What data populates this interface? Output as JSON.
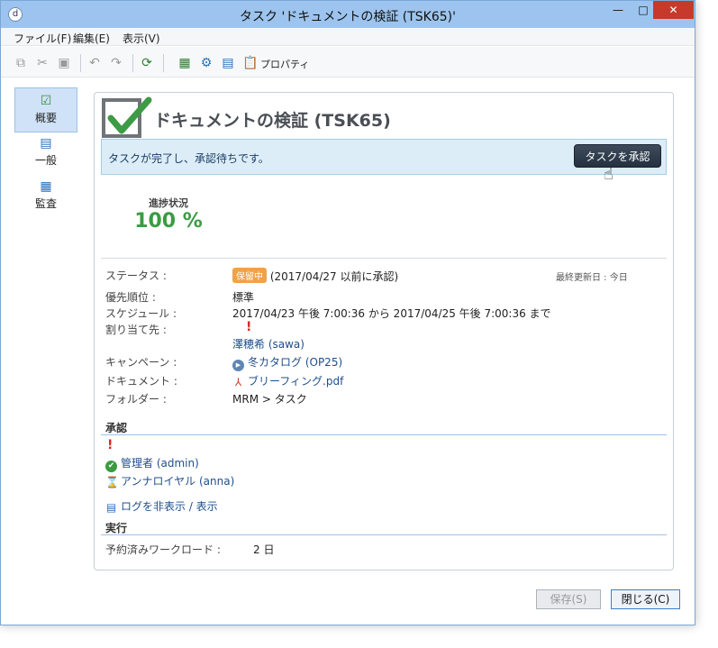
{
  "window": {
    "title": "タスク 'ドキュメントの検証 (TSK65)'",
    "app_icon": "d",
    "minimize": "—",
    "maximize": "□",
    "close": "✕"
  },
  "menu": {
    "file": "ファイル(F)",
    "edit": "編集(E)",
    "view": "表示(V)"
  },
  "toolbar": {
    "properties": "プロパティ"
  },
  "nav": [
    {
      "label": "概要",
      "icon": "☑"
    },
    {
      "label": "一般",
      "icon": "▤"
    },
    {
      "label": "監査",
      "icon": "▦"
    }
  ],
  "card": {
    "title": "ドキュメントの検証 (TSK65)",
    "status_message": "タスクが完了し、承認待ちです。",
    "approve_button": "タスクを承認",
    "progress_label": "進捗状況",
    "progress_value": "100 %"
  },
  "fields": {
    "status_label": "ステータス :",
    "status_badge": "保留中",
    "status_value": "(2017/04/27 以前に承認)",
    "last_updated": "最終更新日 : 今日",
    "priority_label": "優先順位 :",
    "priority_value": "標準",
    "schedule_label": "スケジュール :",
    "schedule_value": "2017/04/23 午後 7:00:36 から 2017/04/25 午後 7:00:36 まで",
    "assignee_label": "割り当て先 :",
    "assignee_mark": "!",
    "assignee_value": "澤穂希 (sawa)",
    "campaign_label": "キャンペーン :",
    "campaign_value": "冬カタログ (OP25)",
    "document_label": "ドキュメント :",
    "document_value": "ブリーフィング.pdf",
    "folder_label": "フォルダー :",
    "folder_value": "MRM > タスク"
  },
  "approval": {
    "heading": "承認",
    "mark": "!",
    "approver1": "管理者 (admin)",
    "approver2": "アンナロイヤル (anna)",
    "log_link": "ログを非表示 / 表示"
  },
  "execution": {
    "heading": "実行",
    "workload_label": "予約済みワークロード :",
    "workload_value": "2 日"
  },
  "buttons": {
    "save": "保存(S)",
    "close": "閉じる(C)"
  }
}
